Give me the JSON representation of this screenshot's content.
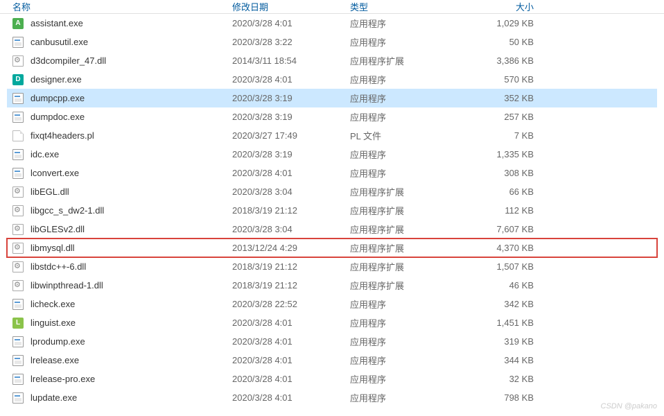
{
  "header": {
    "name": "名称",
    "date": "修改日期",
    "type": "类型",
    "size": "大小"
  },
  "files": [
    {
      "name": "assistant.exe",
      "date": "2020/3/28 4:01",
      "type": "应用程序",
      "size": "1,029 KB",
      "icon": "exe-green",
      "selected": false,
      "highlighted": false
    },
    {
      "name": "canbusutil.exe",
      "date": "2020/3/28 3:22",
      "type": "应用程序",
      "size": "50 KB",
      "icon": "exe",
      "selected": false,
      "highlighted": false
    },
    {
      "name": "d3dcompiler_47.dll",
      "date": "2014/3/11 18:54",
      "type": "应用程序扩展",
      "size": "3,386 KB",
      "icon": "dll",
      "selected": false,
      "highlighted": false
    },
    {
      "name": "designer.exe",
      "date": "2020/3/28 4:01",
      "type": "应用程序",
      "size": "570 KB",
      "icon": "exe-d",
      "selected": false,
      "highlighted": false
    },
    {
      "name": "dumpcpp.exe",
      "date": "2020/3/28 3:19",
      "type": "应用程序",
      "size": "352 KB",
      "icon": "exe",
      "selected": true,
      "highlighted": false
    },
    {
      "name": "dumpdoc.exe",
      "date": "2020/3/28 3:19",
      "type": "应用程序",
      "size": "257 KB",
      "icon": "exe",
      "selected": false,
      "highlighted": false
    },
    {
      "name": "fixqt4headers.pl",
      "date": "2020/3/27 17:49",
      "type": "PL 文件",
      "size": "7 KB",
      "icon": "file",
      "selected": false,
      "highlighted": false
    },
    {
      "name": "idc.exe",
      "date": "2020/3/28 3:19",
      "type": "应用程序",
      "size": "1,335 KB",
      "icon": "exe",
      "selected": false,
      "highlighted": false
    },
    {
      "name": "lconvert.exe",
      "date": "2020/3/28 4:01",
      "type": "应用程序",
      "size": "308 KB",
      "icon": "exe",
      "selected": false,
      "highlighted": false
    },
    {
      "name": "libEGL.dll",
      "date": "2020/3/28 3:04",
      "type": "应用程序扩展",
      "size": "66 KB",
      "icon": "dll",
      "selected": false,
      "highlighted": false
    },
    {
      "name": "libgcc_s_dw2-1.dll",
      "date": "2018/3/19 21:12",
      "type": "应用程序扩展",
      "size": "112 KB",
      "icon": "dll",
      "selected": false,
      "highlighted": false
    },
    {
      "name": "libGLESv2.dll",
      "date": "2020/3/28 3:04",
      "type": "应用程序扩展",
      "size": "7,607 KB",
      "icon": "dll",
      "selected": false,
      "highlighted": false
    },
    {
      "name": "libmysql.dll",
      "date": "2013/12/24 4:29",
      "type": "应用程序扩展",
      "size": "4,370 KB",
      "icon": "dll",
      "selected": false,
      "highlighted": true
    },
    {
      "name": "libstdc++-6.dll",
      "date": "2018/3/19 21:12",
      "type": "应用程序扩展",
      "size": "1,507 KB",
      "icon": "dll",
      "selected": false,
      "highlighted": false
    },
    {
      "name": "libwinpthread-1.dll",
      "date": "2018/3/19 21:12",
      "type": "应用程序扩展",
      "size": "46 KB",
      "icon": "dll",
      "selected": false,
      "highlighted": false
    },
    {
      "name": "licheck.exe",
      "date": "2020/3/28 22:52",
      "type": "应用程序",
      "size": "342 KB",
      "icon": "exe",
      "selected": false,
      "highlighted": false
    },
    {
      "name": "linguist.exe",
      "date": "2020/3/28 4:01",
      "type": "应用程序",
      "size": "1,451 KB",
      "icon": "exe-l",
      "selected": false,
      "highlighted": false
    },
    {
      "name": "lprodump.exe",
      "date": "2020/3/28 4:01",
      "type": "应用程序",
      "size": "319 KB",
      "icon": "exe",
      "selected": false,
      "highlighted": false
    },
    {
      "name": "lrelease.exe",
      "date": "2020/3/28 4:01",
      "type": "应用程序",
      "size": "344 KB",
      "icon": "exe",
      "selected": false,
      "highlighted": false
    },
    {
      "name": "lrelease-pro.exe",
      "date": "2020/3/28 4:01",
      "type": "应用程序",
      "size": "32 KB",
      "icon": "exe",
      "selected": false,
      "highlighted": false
    },
    {
      "name": "lupdate.exe",
      "date": "2020/3/28 4:01",
      "type": "应用程序",
      "size": "798 KB",
      "icon": "exe",
      "selected": false,
      "highlighted": false
    }
  ],
  "watermark": "CSDN @pakano"
}
